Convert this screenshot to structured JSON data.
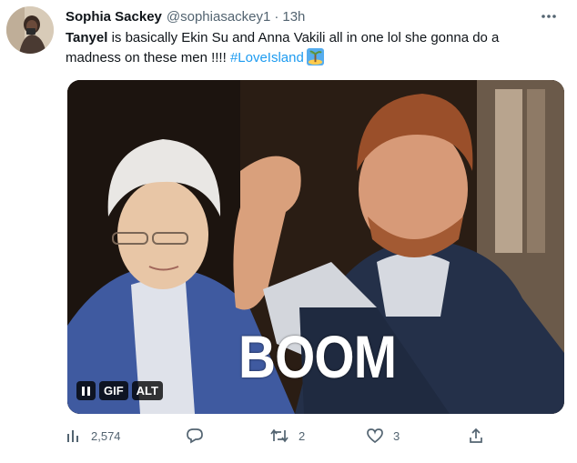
{
  "author": {
    "name": "Sophia Sackey",
    "handle": "@sophiasackey1",
    "separator": "·",
    "time": "13h"
  },
  "tweet": {
    "mention": "Tanyel",
    "text": " is basically Ekin Su and Anna Vakili all in one lol she gonna do a madness on these men !!!! ",
    "hashtag": "#LoveIsland",
    "emoji": "island-emoji"
  },
  "media": {
    "caption": "BOOM",
    "controls": {
      "pause_icon": "pause-icon",
      "gif_label": "GIF",
      "alt_label": "ALT"
    }
  },
  "actions": {
    "views": {
      "icon": "views-icon",
      "count": "2,574"
    },
    "reply": {
      "icon": "reply-icon",
      "count": ""
    },
    "retweet": {
      "icon": "retweet-icon",
      "count": "2"
    },
    "like": {
      "icon": "heart-icon",
      "count": "3"
    },
    "share": {
      "icon": "share-icon"
    }
  },
  "colors": {
    "accent": "#1d9bf0",
    "secondary_text": "#536471",
    "primary_text": "#0f1419"
  }
}
